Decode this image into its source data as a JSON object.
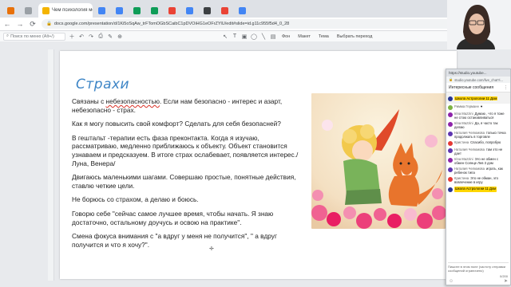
{
  "browser": {
    "tabs": [
      {
        "label": "",
        "color": "#e8710a"
      },
      {
        "label": "",
        "color": "#9aa0a6"
      },
      {
        "label": "Чем психология может помочь",
        "color": "#f4b400"
      },
      {
        "label": "",
        "color": "#4285f4"
      },
      {
        "label": "",
        "color": "#4285f4"
      },
      {
        "label": "",
        "color": "#0f9d58"
      },
      {
        "label": "",
        "color": "#0f9d58"
      },
      {
        "label": "",
        "color": "#ea4335"
      },
      {
        "label": "",
        "color": "#4285f4"
      },
      {
        "label": "",
        "color": "#3c4043"
      },
      {
        "label": "",
        "color": "#ea4335"
      },
      {
        "label": "",
        "color": "#4285f4"
      }
    ],
    "url": "docs.google.com/presentation/d/1Ki5oSqAw_trFTomOGbSCaibC1pDVOiHG1eOFrZYlU/edit#slide=id.g11c955f5d4_0_28"
  },
  "slides_toolbar": {
    "search_placeholder": "Поиск по меню (Alt+/)",
    "background_label": "Фон",
    "layout_label": "Макет",
    "theme_label": "Тема",
    "transition_label": "Выбрать переход"
  },
  "slide": {
    "title": "Страхи",
    "paragraphs": {
      "p1_a": "Связаны с ",
      "p1_u": "небезопасностью",
      "p1_b": ". Если нам безопасно - интерес и азарт, небезопасно - страх.",
      "p2": "Как я могу повысить свой комфорт? Сделать для себя безопасней?",
      "p3": "В гештальт -терапии есть фаза преконтакта. Когда я изучаю, рассматриваю, медленно приближаюсь к объекту. Объект становится узнаваем и предсказуем. В итоге страх ослабевает, появляется интерес./Луна, Венера/",
      "p4": "Двигаюсь маленькими шагами. Совершаю простые, понятные действия, ставлю четкие цели.",
      "p5": "Не борюсь со страхом, а делаю и боюсь.",
      "p6": "Говорю себе \"сейчас самое лучшее время, чтобы начать. Я знаю достаточно, остальному доучусь и освою на практике\".",
      "p7": "Смена фокуса внимания с \"а вдруг у меня не получится\", \" а вдруг получится и что я хочу?\"."
    }
  },
  "chat": {
    "window_title": "https://studio.youtube...",
    "url": "studio.youtube.com/live_chat?i...",
    "header": "Интересные сообщения",
    "pinned_author": "Школа Астрологии 11 Дом",
    "messages": [
      {
        "author": "Римма Германн",
        "text": "♥",
        "color": "#7cb342"
      },
      {
        "author": "Irina Mazzini",
        "text": "Думаю , что я тоже не стою останавливаться",
        "color": "#8e24aa"
      },
      {
        "author": "Irina Mazzini",
        "text": "Да, я часто так делаю",
        "color": "#8e24aa"
      },
      {
        "author": "Наталия Челюмова",
        "text": "только точка продолжать в торговле",
        "color": "#5e35b1"
      },
      {
        "author": "Кристина",
        "text": "Спасибо, попробую",
        "color": "#e53935"
      },
      {
        "author": "Наталия Челюмова",
        "text": "там это не дает",
        "color": "#5e35b1"
      },
      {
        "author": "Irina Mazzini",
        "text": "Это не обмен с обмен Солнце Лев 3 дом",
        "color": "#8e24aa"
      },
      {
        "author": "Наталия Челюмова",
        "text": "играть, как ребенок типа",
        "color": "#5e35b1"
      },
      {
        "author": "Кристина",
        "text": "Это не обман, это вовлечение в игру",
        "color": "#e53935"
      }
    ],
    "owner_author": "Школа Астрологии 11 Дом",
    "input_placeholder": "Пишите в этом поле (частоту отправки сообщений ограничено)",
    "counter": "0/200"
  }
}
